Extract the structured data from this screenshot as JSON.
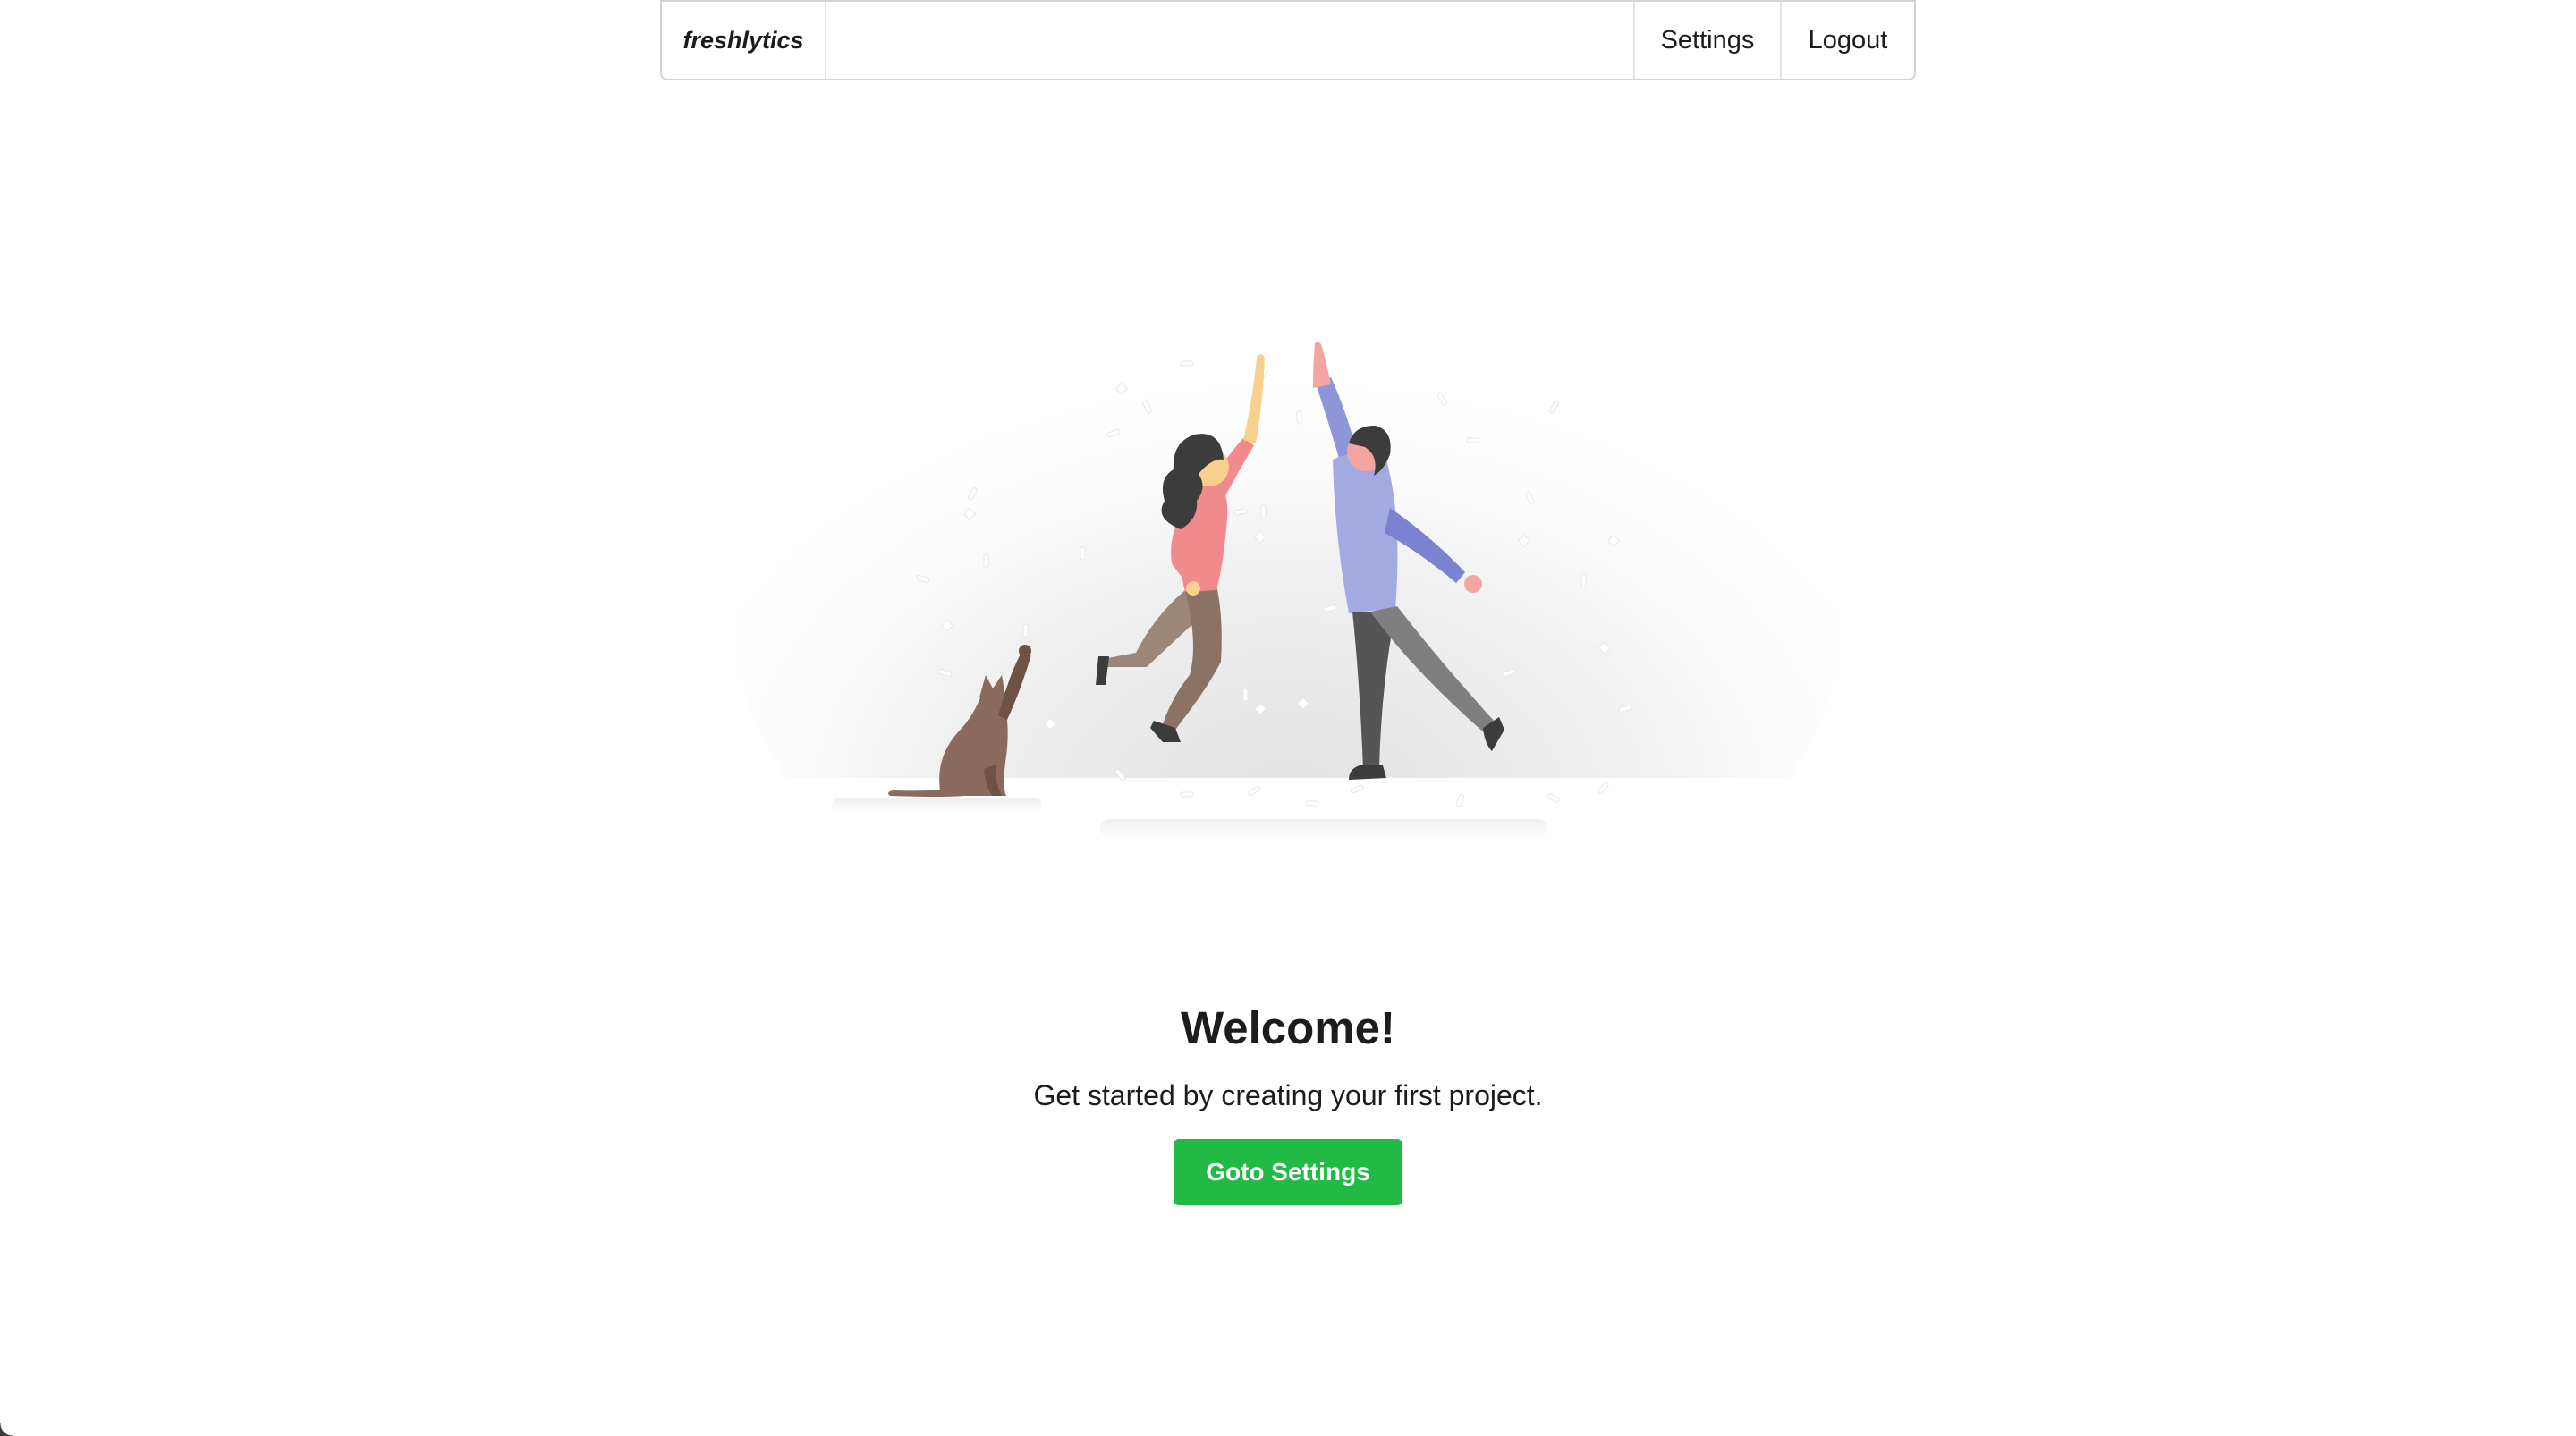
{
  "nav": {
    "brand": "freshlytics",
    "settings_label": "Settings",
    "logout_label": "Logout"
  },
  "main": {
    "illustration_icon": "high-five-illustration",
    "title": "Welcome!",
    "subtitle": "Get started by creating your first project.",
    "button_label": "Goto Settings"
  },
  "colors": {
    "button": "#21ba45",
    "border": "#d4d4d5",
    "text": "#1b1c1d"
  }
}
